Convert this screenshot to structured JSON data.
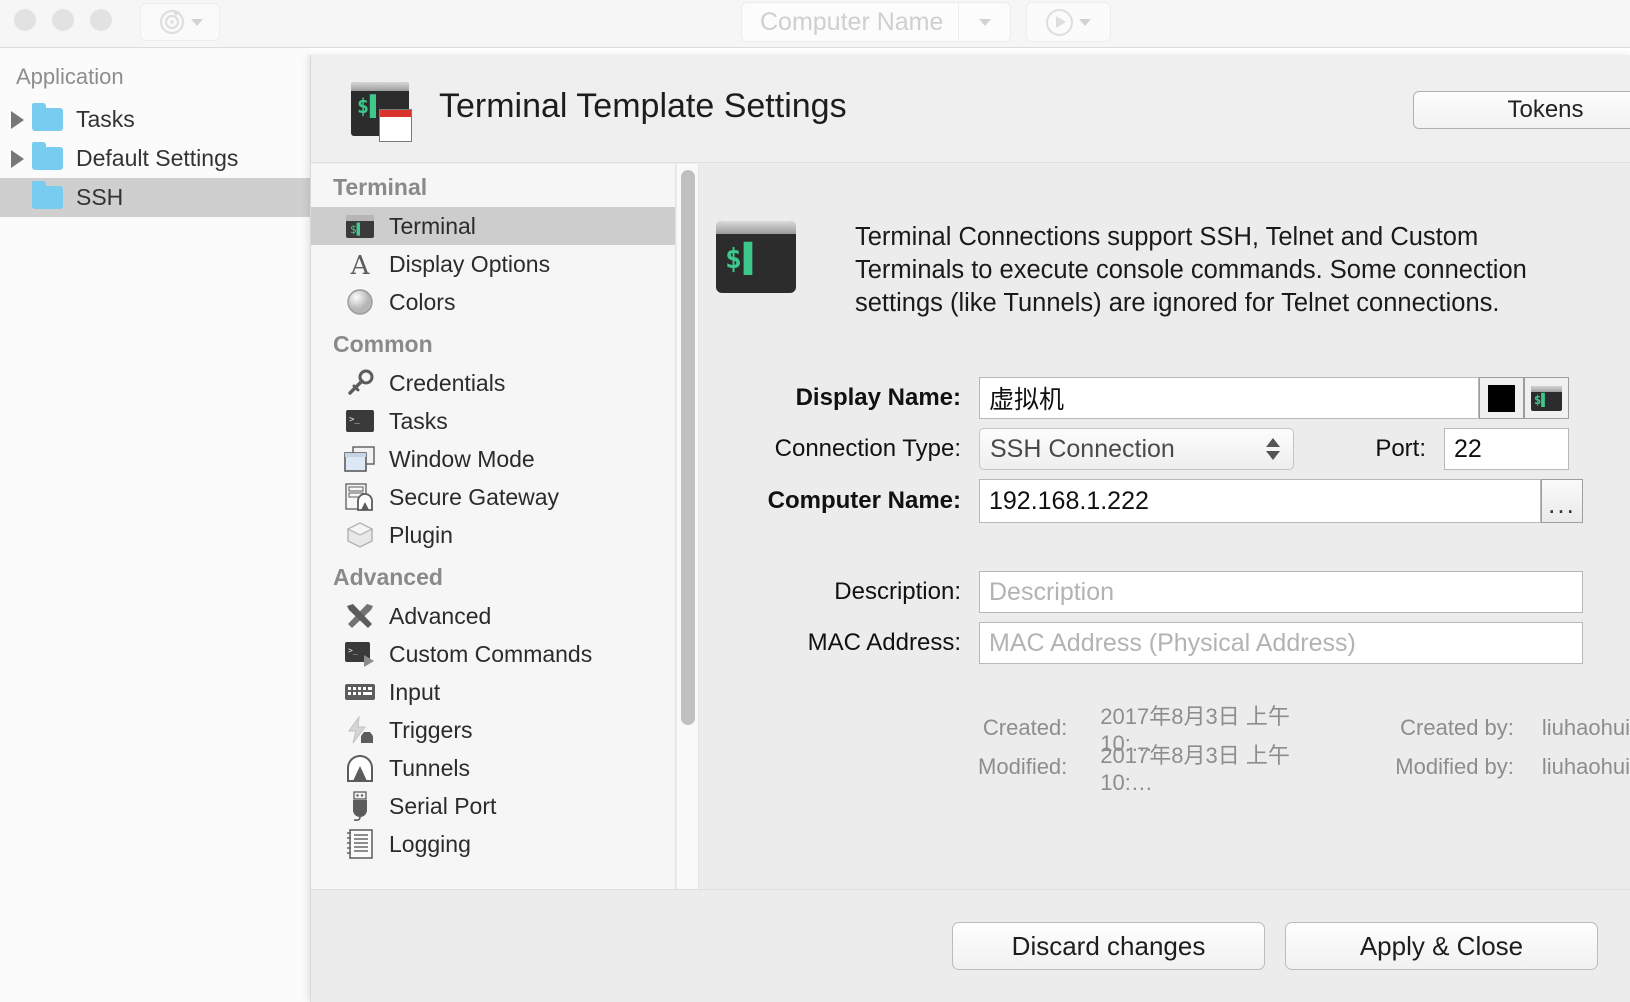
{
  "toolbar": {
    "refresh_icon": "refresh-target-icon",
    "refresh_dropdown_icon": "chevron-down-icon",
    "computer_name_placeholder": "Computer Name",
    "computer_name_value": "",
    "computer_name_dropdown_icon": "chevron-down-icon",
    "run_icon": "play-icon",
    "run_dropdown_icon": "chevron-down-icon",
    "window_buttons": [
      "close-button",
      "minimize-button",
      "zoom-button"
    ]
  },
  "sidebar": {
    "header": "Application",
    "items": [
      {
        "label": "Tasks",
        "icon": "folder-icon",
        "disclosure": "triangle-right-icon",
        "expandable": true,
        "selected": false
      },
      {
        "label": "Default Settings",
        "icon": "folder-icon",
        "disclosure": "triangle-right-icon",
        "expandable": true,
        "selected": false
      },
      {
        "label": "SSH",
        "icon": "folder-icon",
        "disclosure": "",
        "expandable": false,
        "selected": true
      }
    ]
  },
  "dialog": {
    "title": "Terminal Template Settings",
    "title_icon": "terminal-template-icon",
    "tokens_label": "Tokens"
  },
  "nav": {
    "groups": [
      {
        "title": "Terminal",
        "items": [
          {
            "label": "Terminal",
            "icon": "terminal-icon",
            "active": true
          },
          {
            "label": "Display Options",
            "icon": "font-a-icon",
            "active": false
          },
          {
            "label": "Colors",
            "icon": "color-circle-icon",
            "active": false
          }
        ]
      },
      {
        "title": "Common",
        "items": [
          {
            "label": "Credentials",
            "icon": "key-icon",
            "active": false
          },
          {
            "label": "Tasks",
            "icon": "terminal-dark-icon",
            "active": false
          },
          {
            "label": "Window Mode",
            "icon": "windows-stack-icon",
            "active": false
          },
          {
            "label": "Secure Gateway",
            "icon": "server-tunnel-icon",
            "active": false
          },
          {
            "label": "Plugin",
            "icon": "plugin-cube-icon",
            "active": false
          }
        ]
      },
      {
        "title": "Advanced",
        "items": [
          {
            "label": "Advanced",
            "icon": "tools-icon",
            "active": false
          },
          {
            "label": "Custom Commands",
            "icon": "terminal-play-icon",
            "active": false
          },
          {
            "label": "Input",
            "icon": "keyboard-icon",
            "active": false
          },
          {
            "label": "Triggers",
            "icon": "lightning-icon",
            "active": false
          },
          {
            "label": "Tunnels",
            "icon": "tunnel-arch-icon",
            "active": false
          },
          {
            "label": "Serial Port",
            "icon": "usb-plug-icon",
            "active": false
          },
          {
            "label": "Logging",
            "icon": "log-document-icon",
            "active": false
          }
        ]
      }
    ]
  },
  "content": {
    "intro_icon": "terminal-icon-large",
    "intro_text": "Terminal Connections support SSH, Telnet and Custom Terminals to execute console commands. Some connection settings (like Tunnels) are ignored for Telnet connections.",
    "fields": {
      "display_name_label": "Display Name:",
      "display_name_value": "虚拟机",
      "color_swatch": "#000000",
      "terminal_icon_button": "terminal-preview-icon",
      "connection_type_label": "Connection Type:",
      "connection_type_value": "SSH Connection",
      "connection_type_options": [
        "SSH Connection"
      ],
      "port_label": "Port:",
      "port_value": "22",
      "computer_name_label": "Computer Name:",
      "computer_name_value": "192.168.1.222",
      "browse_label": "...",
      "description_label": "Description:",
      "description_value": "",
      "description_placeholder": "Description",
      "mac_label": "MAC Address:",
      "mac_value": "",
      "mac_placeholder": "MAC Address (Physical Address)"
    },
    "meta": {
      "created_label": "Created:",
      "created_value": "2017年8月3日 上午10:…",
      "created_by_label": "Created by:",
      "created_by_value": "liuhaohui",
      "modified_label": "Modified:",
      "modified_value": "2017年8月3日 上午10:…",
      "modified_by_label": "Modified by:",
      "modified_by_value": "liuhaohui"
    }
  },
  "footer": {
    "discard_label": "Discard changes",
    "apply_label": "Apply & Close"
  }
}
